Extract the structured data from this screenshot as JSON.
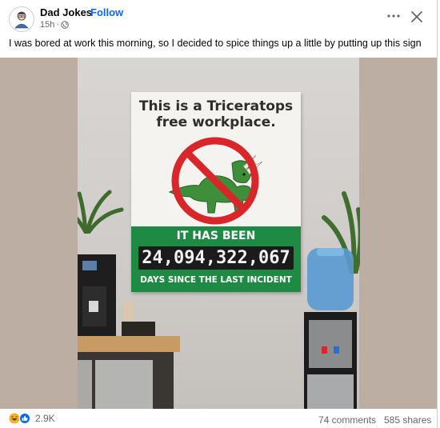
{
  "post": {
    "page_name": "Dad Jokes",
    "separator": "·",
    "follow_label": "Follow",
    "time": "15h",
    "time_sep": "·",
    "visibility_icon": "globe-icon",
    "more_icon": "more-horizontal-icon",
    "close_icon": "close-icon",
    "caption": "I was bored at work this morning, so I decided to spice things up a little by putting up this sign"
  },
  "image": {
    "sign_title_line1": "This is a Triceratops",
    "sign_title_line2": "free workplace.",
    "band_top": "IT HAS BEEN",
    "counter": "24,094,322,067",
    "band_bottom": "DAYS SINCE THE LAST INCIDENT"
  },
  "footer": {
    "reaction_icons": [
      "haha-icon",
      "like-icon"
    ],
    "reaction_count": "2.9K",
    "comments": "74 comments",
    "shares": "585 shares"
  },
  "colors": {
    "link_blue": "#0866ff",
    "sign_green": "#1f8a43",
    "prohibition_red": "#d9262b",
    "dino_green": "#3f8f3a"
  }
}
